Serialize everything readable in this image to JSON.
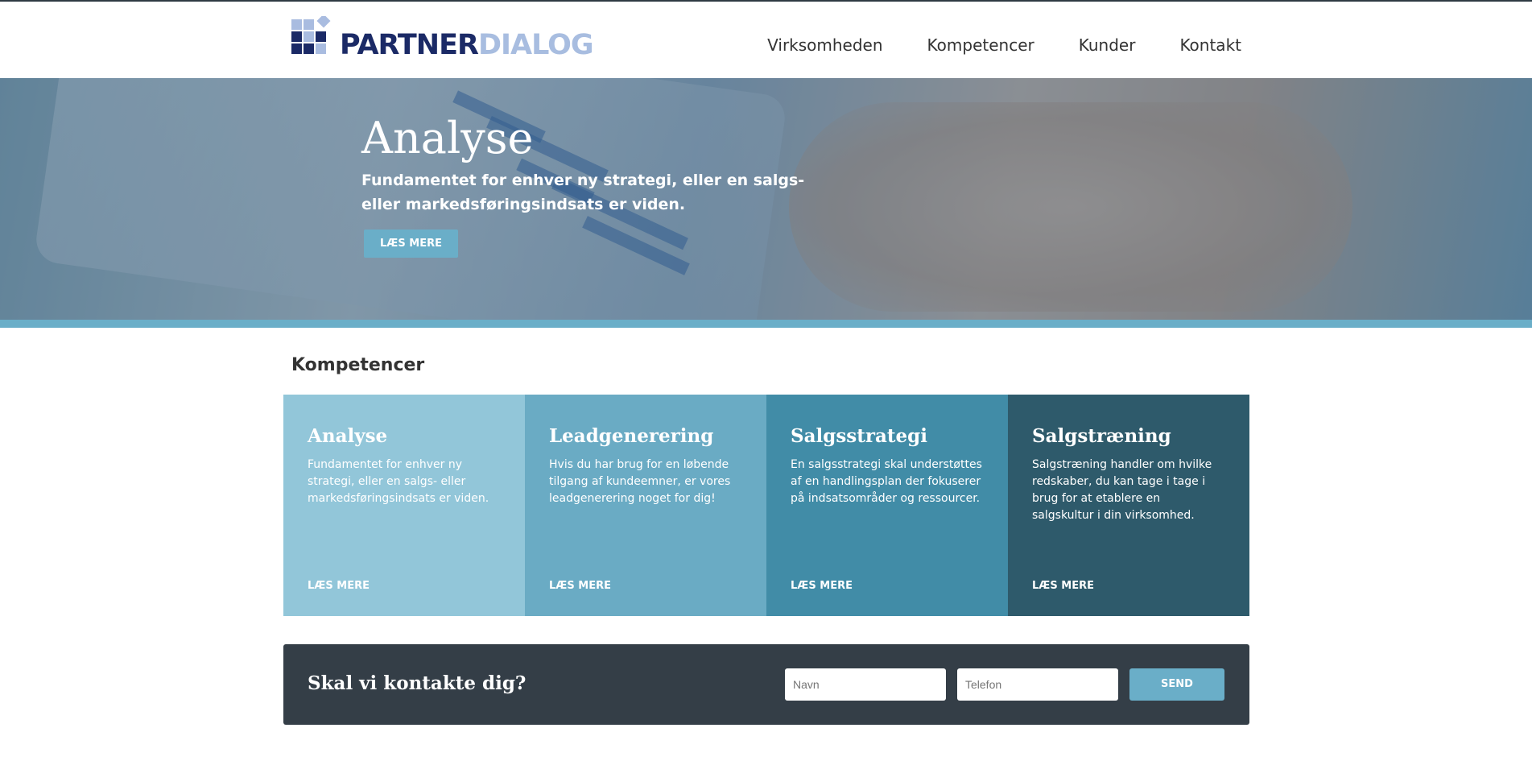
{
  "brand": {
    "part1": "PARTNER",
    "part2": "DIALOG"
  },
  "nav": {
    "items": [
      "Virksomheden",
      "Kompetencer",
      "Kunder",
      "Kontakt"
    ]
  },
  "hero": {
    "title": "Analyse",
    "text": "Fundamentet for enhver ny strategi, eller en salgs- eller markedsføringsindsats er viden.",
    "button": "LÆS MERE"
  },
  "section": {
    "title": "Kompetencer"
  },
  "cards": [
    {
      "title": "Analyse",
      "text": "Fundamentet for enhver ny strategi, eller en salgs- eller markedsføringsindsats er viden.",
      "link": "LÆS MERE",
      "color": "#92c6d9"
    },
    {
      "title": "Leadgenerering",
      "text": "Hvis du har brug for en løbende tilgang af kundeemner, er vores leadgenerering noget for dig!",
      "link": "LÆS MERE",
      "color": "#6aabc4"
    },
    {
      "title": "Salgsstrategi",
      "text": "En salgsstrategi skal understøttes af en handlingsplan der fokuserer på indsatsområder og ressourcer.",
      "link": "LÆS MERE",
      "color": "#418ca7"
    },
    {
      "title": "Salgstræning",
      "text": "Salgstræning handler om hvilke redskaber, du kan tage i tage i brug for at etablere en salgskultur i din virksomhed.",
      "link": "LÆS MERE",
      "color": "#2e5a6b"
    }
  ],
  "contact": {
    "title": "Skal vi kontakte dig?",
    "name_placeholder": "Navn",
    "phone_placeholder": "Telefon",
    "send": "SEND"
  }
}
